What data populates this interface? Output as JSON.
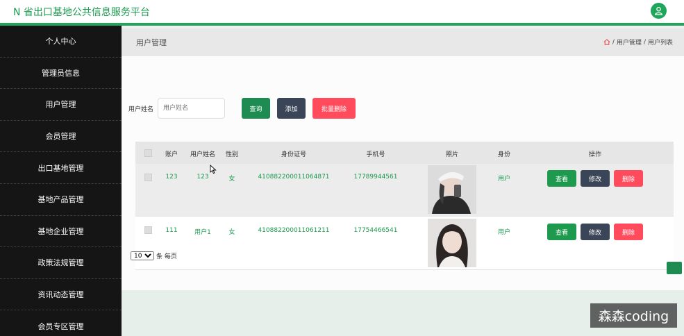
{
  "header": {
    "title": "N 省出口基地公共信息服务平台",
    "user_icon": "user-icon"
  },
  "sidebar": {
    "items": [
      {
        "label": "个人中心"
      },
      {
        "label": "管理员信息"
      },
      {
        "label": "用户管理"
      },
      {
        "label": "会员管理"
      },
      {
        "label": "出口基地管理"
      },
      {
        "label": "基地产品管理"
      },
      {
        "label": "基地企业管理"
      },
      {
        "label": "政策法规管理"
      },
      {
        "label": "资讯动态管理"
      },
      {
        "label": "会员专区管理"
      }
    ]
  },
  "page": {
    "title": "用户管理",
    "breadcrumb": {
      "home_icon": "home-icon",
      "sep": "/",
      "level1": "用户管理",
      "level2": "用户列表"
    }
  },
  "search": {
    "label": "用户姓名",
    "placeholder": "用户姓名",
    "query_label": "查询",
    "add_label": "添加",
    "batch_delete_label": "批量删除"
  },
  "table": {
    "headers": {
      "account": "账户",
      "name": "用户姓名",
      "gender": "性别",
      "idcard": "身份证号",
      "phone": "手机号",
      "photo": "照片",
      "identity": "身份",
      "actions": "操作"
    },
    "rows": [
      {
        "account": "123",
        "name": "123",
        "gender": "女",
        "idcard": "410882200011064871",
        "phone": "17789944561",
        "identity": "用户"
      },
      {
        "account": "111",
        "name": "用户1",
        "gender": "女",
        "idcard": "410882200011061211",
        "phone": "17754466541",
        "identity": "用户"
      }
    ],
    "action_labels": {
      "view": "查看",
      "edit": "修改",
      "delete": "删除"
    }
  },
  "pagination": {
    "page_size": "10",
    "page_size_suffix": "条 每页"
  },
  "watermark": "森森coding",
  "colors": {
    "brand": "#1ea65a",
    "sidebar": "#151515",
    "danger": "#ff4b5c",
    "dark": "#3a4557"
  }
}
